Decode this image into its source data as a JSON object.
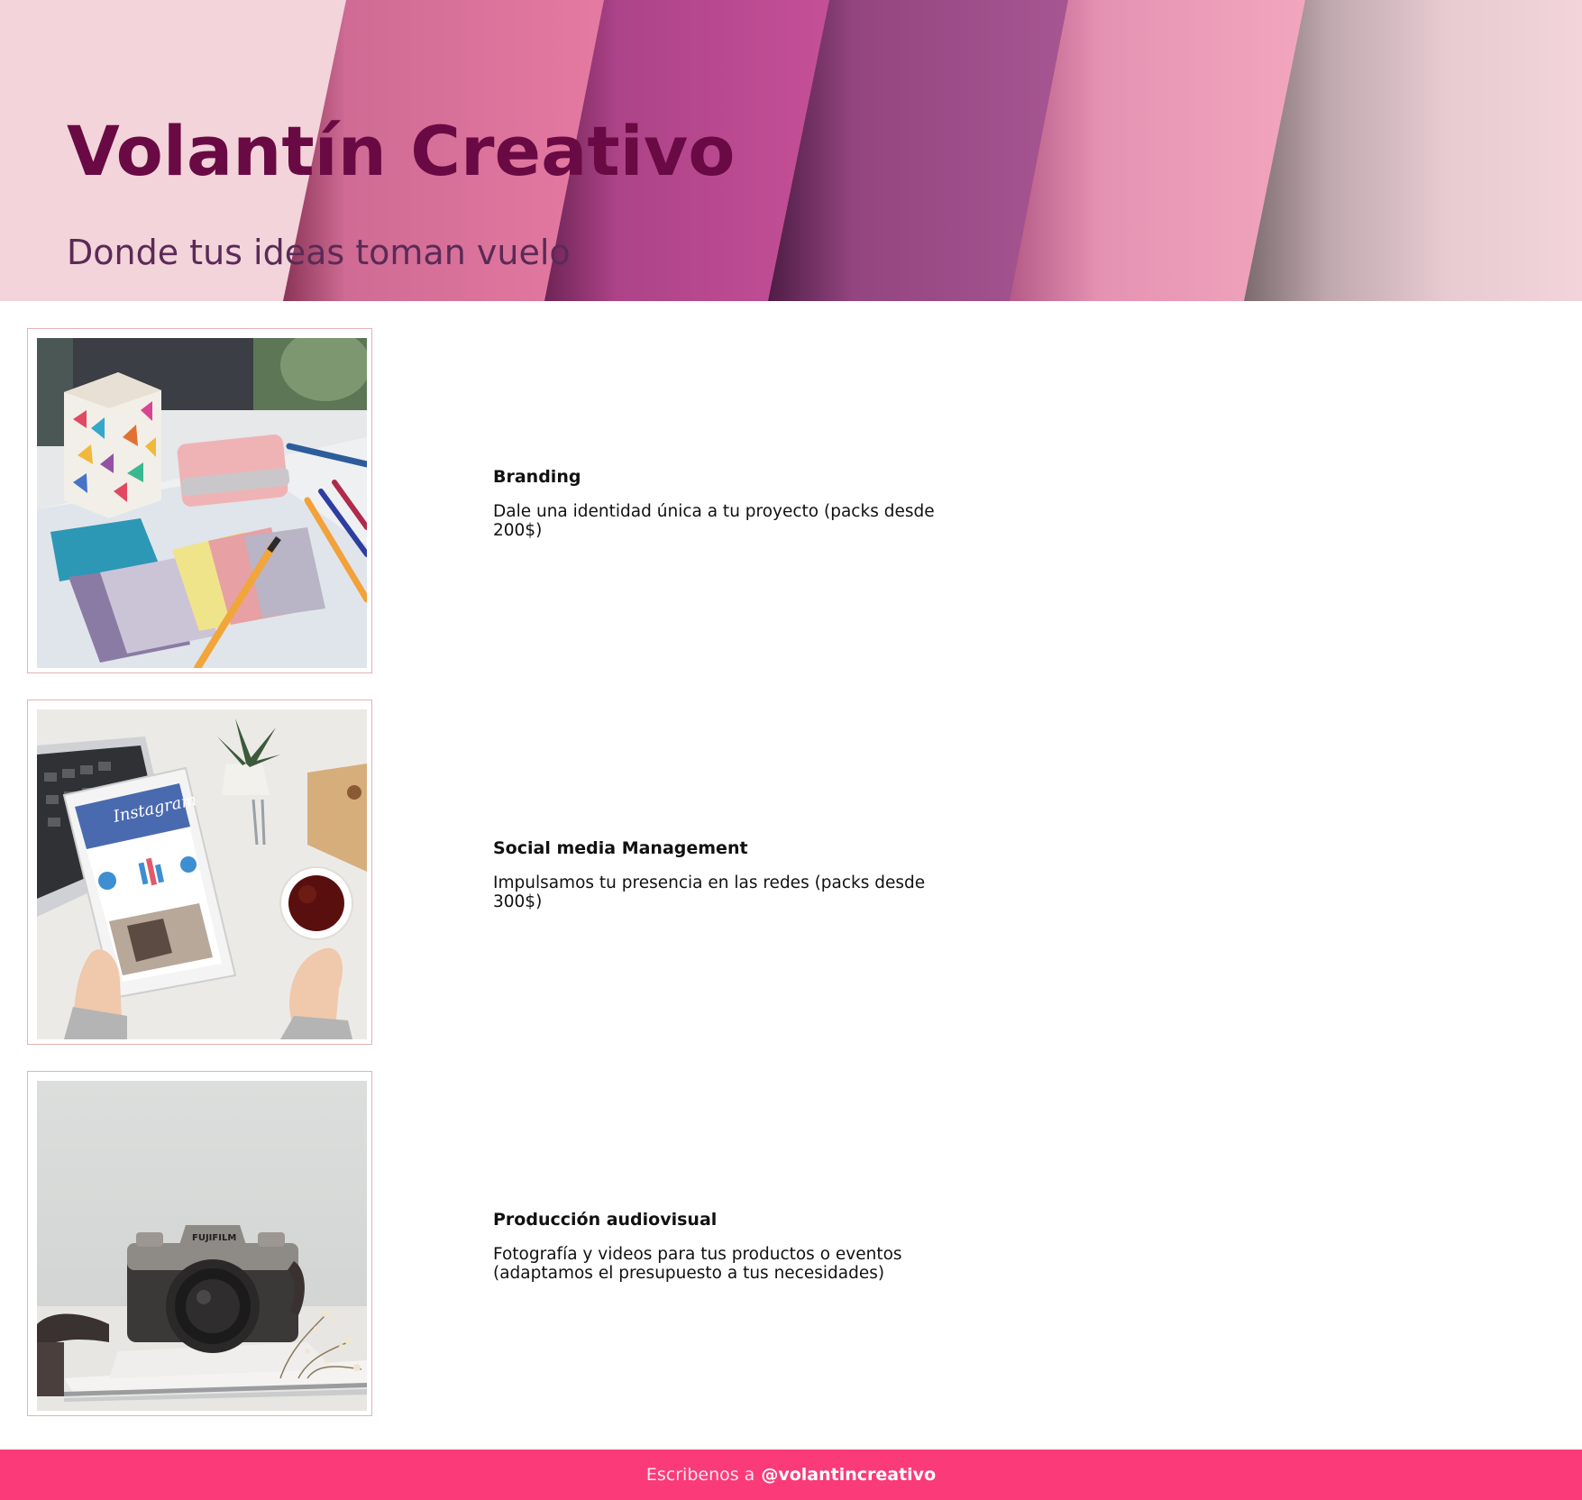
{
  "header": {
    "title": "Volantín Creativo",
    "tagline": "Donde tus ideas toman vuelo"
  },
  "services": [
    {
      "title": "Branding",
      "description": "Dale una identidad única a tu proyecto (packs desde 200$)",
      "photo_icon": "color-swatches-photo"
    },
    {
      "title": "Social media Management",
      "description": "Impulsamos tu presencia en las redes (packs desde 300$)",
      "photo_icon": "tablet-instagram-photo",
      "photo_text": "Instagram"
    },
    {
      "title": "Producción audiovisual",
      "description": "Fotografía y videos para tus productos o eventos (adaptamos el presupuesto a tus necesidades)",
      "photo_icon": "camera-photo",
      "photo_text": "FUJIFILM"
    }
  ],
  "footer": {
    "prefix": "Escribenos a",
    "handle": "@volantincreativo"
  },
  "colors": {
    "header_background": "#f2d4da",
    "title": "#6a0a44",
    "tagline": "#5b2a57",
    "footer_background": "#fb3a7a",
    "image_border": "#e2b3b3"
  }
}
